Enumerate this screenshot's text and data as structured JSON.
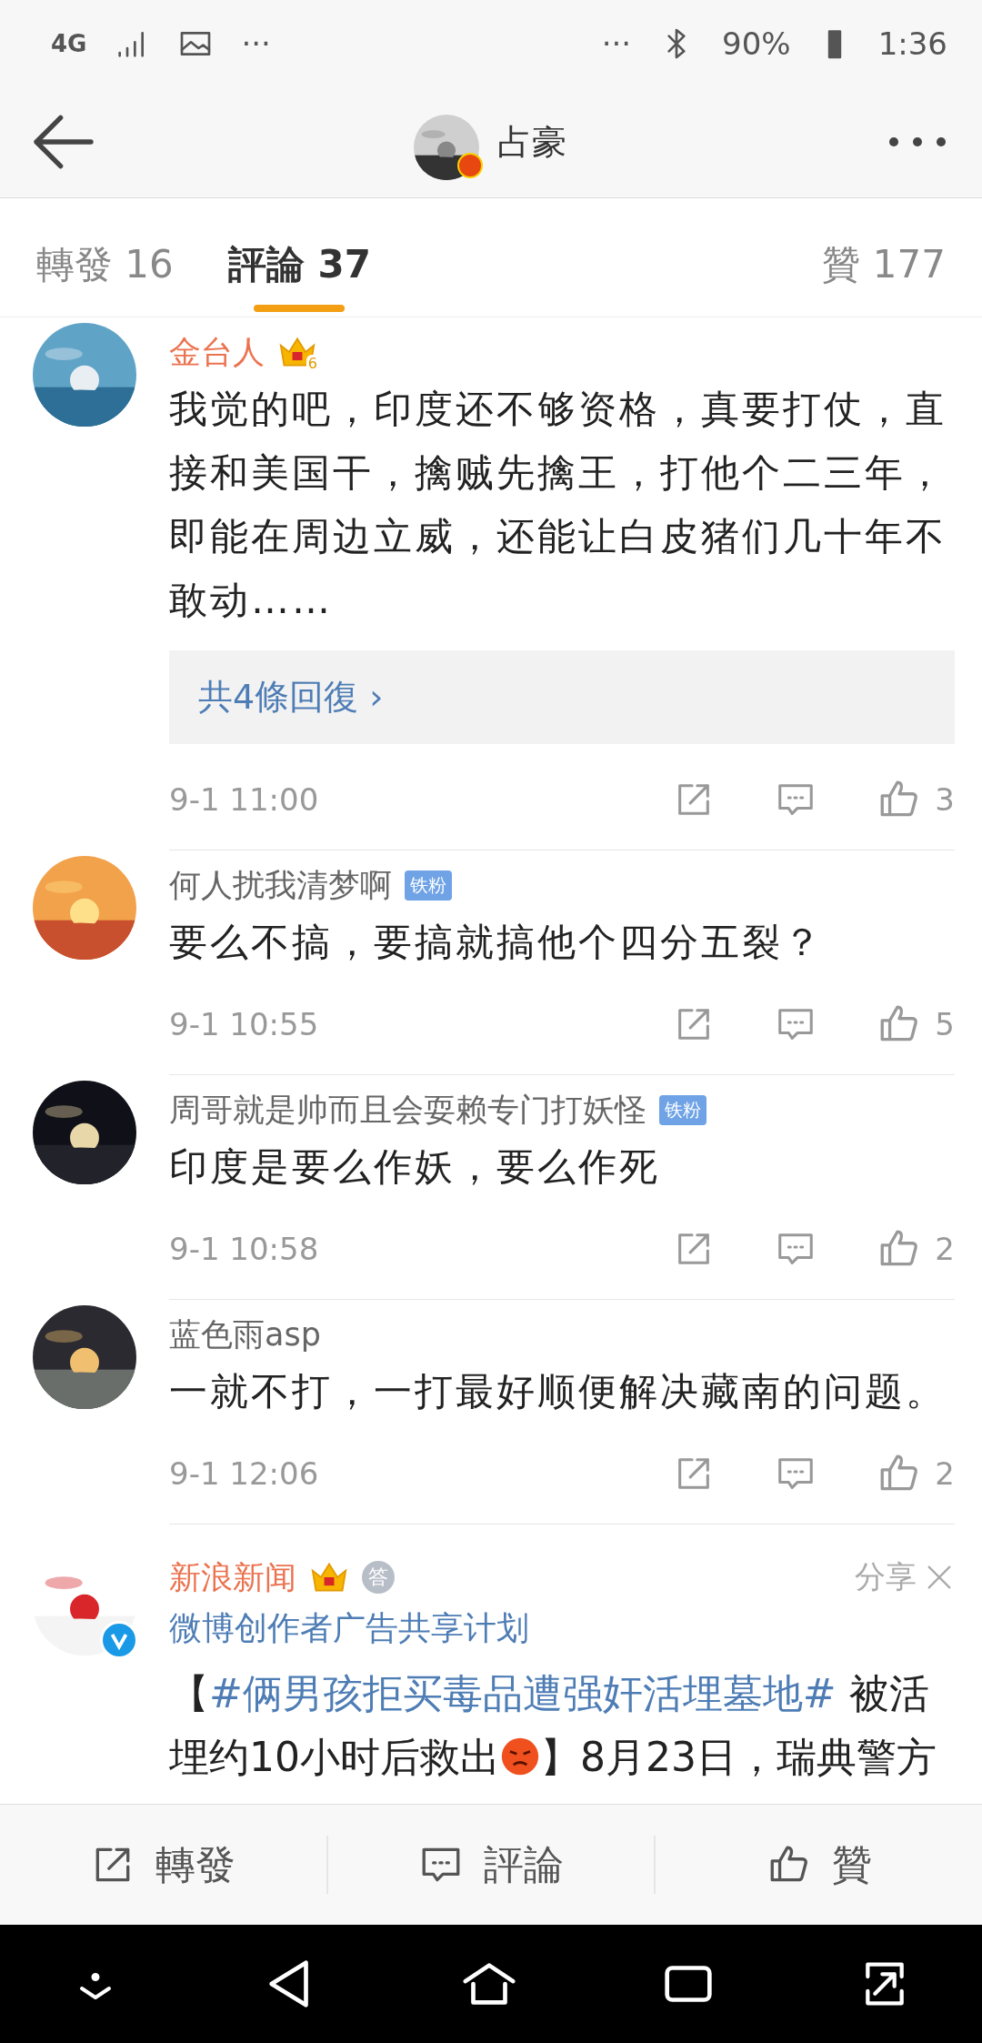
{
  "status_bar": {
    "network": "4G",
    "left_more": "···",
    "right_more": "···",
    "battery": "90%",
    "time": "1:36"
  },
  "header": {
    "title": "占豪",
    "verified": true
  },
  "tabs": [
    {
      "label": "轉發 16",
      "selected": false
    },
    {
      "label": "評論 37",
      "selected": true
    },
    {
      "label": "贊 177",
      "selected": false
    }
  ],
  "comments": [
    {
      "name": "金台人",
      "vip": true,
      "badges": [
        {
          "kind": "crown",
          "label": "6"
        }
      ],
      "text": "我觉的吧，印度还不够资格，真要打仗，直接和美国干，擒贼先擒王，打他个二三年，即能在周边立威，还能让白皮猪们几十年不敢动……",
      "replies": "共4條回復 ›",
      "time": "9-1 11:00",
      "likes": "3"
    },
    {
      "name": "何人扰我清梦啊",
      "vip": false,
      "badges": [
        {
          "kind": "fan",
          "label": "铁粉"
        }
      ],
      "text": "要么不搞，要搞就搞他个四分五裂？",
      "time": "9-1 10:55",
      "likes": "5"
    },
    {
      "name": "周哥就是帅而且会耍赖专门打妖怪",
      "vip": false,
      "badges": [
        {
          "kind": "fan",
          "label": "铁粉"
        }
      ],
      "text": "印度是要么作妖，要么作死",
      "time": "9-1 10:58",
      "likes": "2"
    },
    {
      "name": "蓝色雨asp",
      "vip": false,
      "text": "一就不打，一打最好顺便解决藏南的问题。",
      "time": "9-1 12:06",
      "likes": "2"
    }
  ],
  "promoted": {
    "name": "新浪新闻",
    "vip": true,
    "verified": true,
    "badges": [
      {
        "kind": "crown"
      },
      {
        "kind": "medal",
        "label": "答"
      }
    ],
    "subtitle": "微博创作者广告共享计划",
    "dismiss": "分享",
    "text_start": "【",
    "hashtag": "#俩男孩拒买毒品遭强奸活埋墓地#",
    "text_middle": " 被活埋约10小时后救出",
    "text_end": "】8月23日，瑞典警方"
  },
  "actions": [
    {
      "kind": "repost",
      "label": "轉發"
    },
    {
      "kind": "comment",
      "label": "評論"
    },
    {
      "kind": "like",
      "label": "贊"
    }
  ]
}
